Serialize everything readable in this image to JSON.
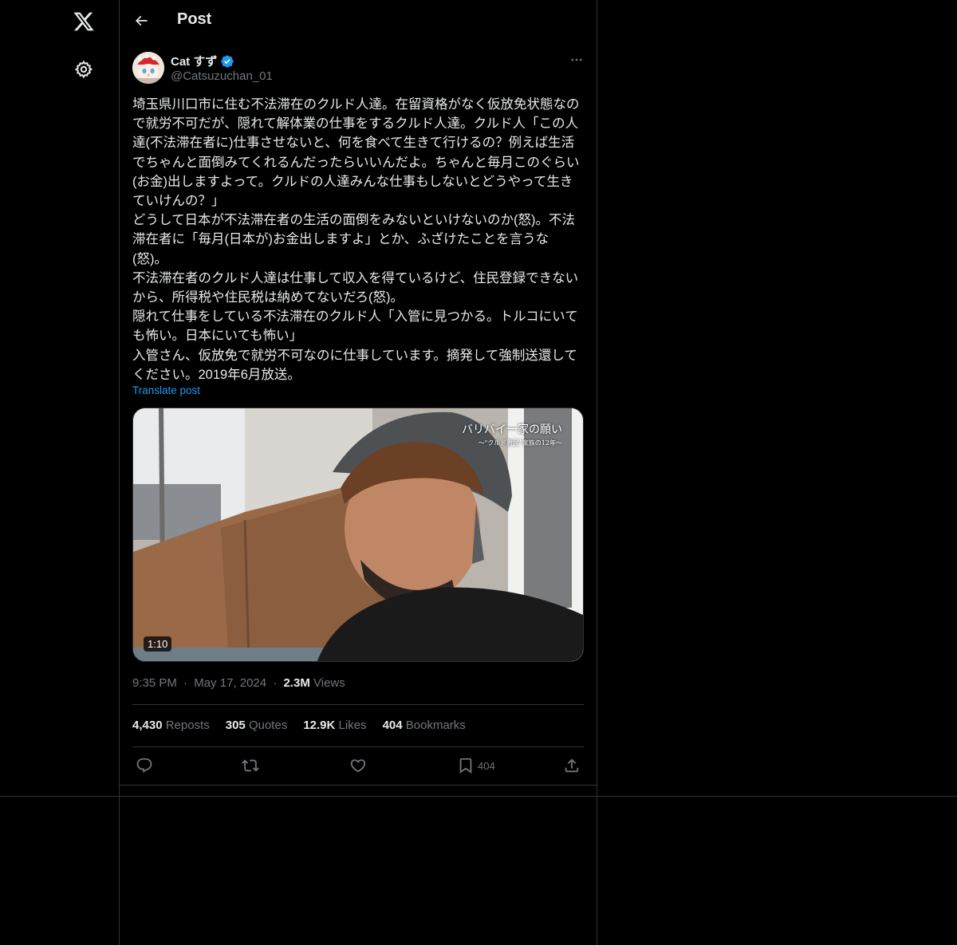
{
  "header": {
    "title": "Post"
  },
  "author": {
    "name": "Cat すず",
    "handle": "@Catsuzuchan_01"
  },
  "post": {
    "paragraphs": [
      "埼玉県川口市に住む不法滞在のクルド人達。在留資格がなく仮放免状態なので就労不可だが、隠れて解体業の仕事をするクルド人達。クルド人「この人達(不法滞在者に)仕事させないと、何を食べて生きて行けるの？例えば生活でちゃんと面倒みてくれるんだったらいいんだよ。ちゃんと毎月このぐらい(お金)出しますよって。クルドの人達みんな仕事もしないとどうやって生きていけんの？」",
      "どうして日本が不法滞在者の生活の面倒をみないといけないのか(怒)。不法滞在者に「毎月(日本が)お金出しますよ」とか、ふざけたことを言うな(怒)。",
      "不法滞在者のクルド人達は仕事して収入を得ているけど、住民登録できないから、所得税や住民税は納めてないだろ(怒)。",
      "隠れて仕事をしている不法滞在のクルド人「入管に見つかる。トルコにいても怖い。日本にいても怖い」",
      "入管さん、仮放免で就労不可なのに仕事しています。摘発して強制送還してください。2019年6月放送。"
    ],
    "translate_label": "Translate post"
  },
  "media": {
    "duration": "1:10",
    "caption_title": "バリバイ一家の願い",
    "caption_sub": "～\"クルド難民\"家族の12年～"
  },
  "meta": {
    "time": "9:35 PM",
    "sep": "·",
    "date": "May 17, 2024",
    "views_count": "2.3M",
    "views_label": "Views"
  },
  "stats": {
    "reposts_count": "4,430",
    "reposts_label": "Reposts",
    "quotes_count": "305",
    "quotes_label": "Quotes",
    "likes_count": "12.9K",
    "likes_label": "Likes",
    "bookmarks_count": "404",
    "bookmarks_label": "Bookmarks"
  },
  "actions": {
    "bookmark_count": "404"
  },
  "colors": {
    "background": "#000000",
    "text": "#e7e9ea",
    "muted": "#71767b",
    "accent": "#1d9bf0",
    "border": "#2f3336"
  },
  "icons": [
    "x-logo-icon",
    "gear-icon",
    "back-arrow-icon",
    "verified-badge-icon",
    "more-icon",
    "reply-icon",
    "repost-icon",
    "like-icon",
    "bookmark-icon",
    "share-icon"
  ]
}
